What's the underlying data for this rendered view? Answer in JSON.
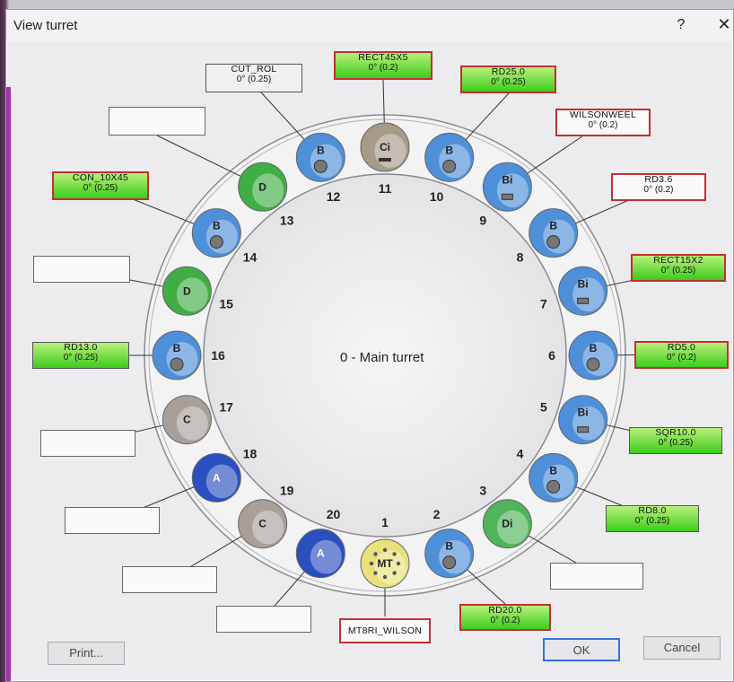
{
  "window": {
    "title": "View turret",
    "help": "?",
    "close": "✕"
  },
  "center_label": "0 - Main turret",
  "stations": [
    {
      "num": "1",
      "letter": "MT",
      "color": "#e8e07a"
    },
    {
      "num": "2",
      "letter": "B",
      "color": "#4d8fd8"
    },
    {
      "num": "3",
      "letter": "Di",
      "color": "#4fb45a"
    },
    {
      "num": "4",
      "letter": "B",
      "color": "#4d8fd8"
    },
    {
      "num": "5",
      "letter": "Bi",
      "color": "#4d8fd8"
    },
    {
      "num": "6",
      "letter": "B",
      "color": "#4d8fd8"
    },
    {
      "num": "7",
      "letter": "Bi",
      "color": "#4d8fd8"
    },
    {
      "num": "8",
      "letter": "B",
      "color": "#4d8fd8"
    },
    {
      "num": "9",
      "letter": "Bi",
      "color": "#4d8fd8"
    },
    {
      "num": "10",
      "letter": "B",
      "color": "#4d8fd8"
    },
    {
      "num": "11",
      "letter": "Ci",
      "color": "#a69a88"
    },
    {
      "num": "12",
      "letter": "B",
      "color": "#4d8fd8"
    },
    {
      "num": "13",
      "letter": "D",
      "color": "#3fae45"
    },
    {
      "num": "14",
      "letter": "B",
      "color": "#4d8fd8"
    },
    {
      "num": "15",
      "letter": "D",
      "color": "#3fae45"
    },
    {
      "num": "16",
      "letter": "B",
      "color": "#4d8fd8"
    },
    {
      "num": "17",
      "letter": "C",
      "color": "#a8a098"
    },
    {
      "num": "18",
      "letter": "A",
      "color": "#2a4fc0"
    },
    {
      "num": "19",
      "letter": "C",
      "color": "#a8a098"
    },
    {
      "num": "20",
      "letter": "A",
      "color": "#2a4fc0"
    }
  ],
  "tool_labels": {
    "rect45x5": {
      "name": "RECT45X5",
      "value": "0° (0.2)"
    },
    "rd25": {
      "name": "RD25.0",
      "value": "0° (0.25)"
    },
    "wilsonweel": {
      "name": "WILSONWEEL",
      "value": "0° (0.2)"
    },
    "rd36": {
      "name": "RD3.6",
      "value": "0° (0.2)"
    },
    "rect15x2": {
      "name": "RECT15X2",
      "value": "0° (0.25)"
    },
    "rd5": {
      "name": "RD5.0",
      "value": "0° (0.2)"
    },
    "sqr10": {
      "name": "SQR10.0",
      "value": "0° (0.25)"
    },
    "rd8": {
      "name": "RD8.0",
      "value": "0° (0.25)"
    },
    "rd20": {
      "name": "RD20.0",
      "value": "0° (0.2)"
    },
    "mt8ri": {
      "name": "MT8RI_WILSON",
      "value": ""
    },
    "cutrol": {
      "name": "CUT_ROL",
      "value": "0° (0.25)"
    },
    "con10x45": {
      "name": "CON_10X45",
      "value": "0° (0.25)"
    },
    "rd13": {
      "name": "RD13.0",
      "value": "0° (0.25)"
    }
  },
  "buttons": {
    "print": "Print...",
    "ok": "OK",
    "cancel": "Cancel"
  },
  "colors": {
    "green_label": "#3dcc1d",
    "red_border": "#c23030",
    "blue_station": "#4d8fd8",
    "green_station": "#3fae45",
    "gray_station": "#a8a098",
    "dark_blue_station": "#2a4fc0",
    "mt_station": "#e8e07a"
  }
}
